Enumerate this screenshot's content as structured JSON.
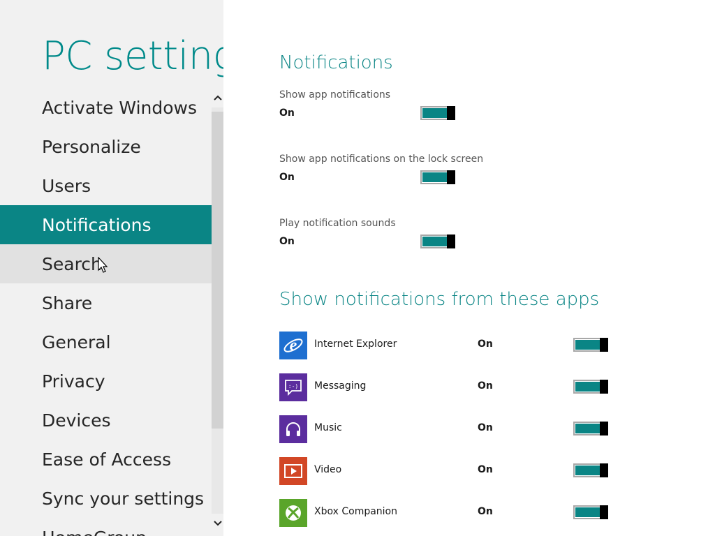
{
  "window": {
    "title": "PC settings"
  },
  "sidebar": {
    "items": [
      {
        "label": "Activate Windows"
      },
      {
        "label": "Personalize"
      },
      {
        "label": "Users"
      },
      {
        "label": "Notifications",
        "selected": true
      },
      {
        "label": "Search",
        "hover": true
      },
      {
        "label": "Share"
      },
      {
        "label": "General"
      },
      {
        "label": "Privacy"
      },
      {
        "label": "Devices"
      },
      {
        "label": "Ease of Access"
      },
      {
        "label": "Sync your settings"
      },
      {
        "label": "HomeGroup"
      }
    ]
  },
  "main": {
    "notifications_heading": "Notifications",
    "settings": [
      {
        "label": "Show app notifications",
        "state": "On"
      },
      {
        "label": "Show app notifications on the lock screen",
        "state": "On"
      },
      {
        "label": "Play notification sounds",
        "state": "On"
      }
    ],
    "apps_heading": "Show notifications from these apps",
    "apps": [
      {
        "name": "Internet Explorer",
        "state": "On",
        "icon": "internet-explorer-icon",
        "color": "#1e6fd0"
      },
      {
        "name": "Messaging",
        "state": "On",
        "icon": "messaging-icon",
        "color": "#5b2d9e"
      },
      {
        "name": "Music",
        "state": "On",
        "icon": "music-headphones-icon",
        "color": "#5b2d9e"
      },
      {
        "name": "Video",
        "state": "On",
        "icon": "video-icon",
        "color": "#d24726"
      },
      {
        "name": "Xbox Companion",
        "state": "On",
        "icon": "xbox-icon",
        "color": "#5aa52a"
      }
    ]
  },
  "colors": {
    "accent": "#0a8585",
    "nav_background": "#f1f1f1",
    "toggle_knob": "#000000"
  }
}
